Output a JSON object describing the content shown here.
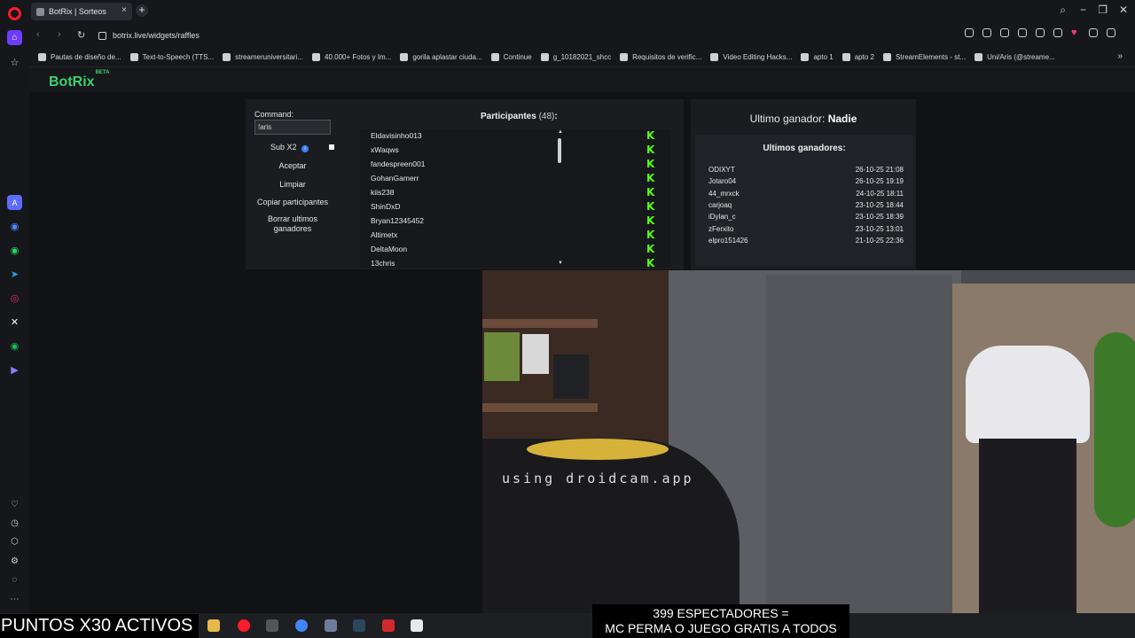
{
  "browser": {
    "tab_title": "BotRix | Sorteos",
    "tab_close": "×",
    "new_tab": "+",
    "url": "botrix.live/widgets/raffles",
    "window_controls": [
      "−",
      "❐",
      "✕"
    ]
  },
  "bookmarks": [
    {
      "label": "Pautas de diseño de...",
      "icon": "doc-icon"
    },
    {
      "label": "Text-to-Speech (TTS...",
      "icon": "tts-icon"
    },
    {
      "label": "streameruniversitari...",
      "icon": "twitch-icon"
    },
    {
      "label": "40.000+ Fotos y Im...",
      "icon": "photo-icon"
    },
    {
      "label": "gorila aplastar ciuda...",
      "icon": "google-icon"
    },
    {
      "label": "Continue",
      "icon": "doc-icon"
    },
    {
      "label": "g_10182021_shcc",
      "icon": "cloud-icon"
    },
    {
      "label": "Requisitos de verific...",
      "icon": "x-icon"
    },
    {
      "label": "Video Editing Hacks...",
      "icon": "youtube-icon"
    },
    {
      "label": "apto 1",
      "icon": "airbnb-icon"
    },
    {
      "label": "apto 2",
      "icon": "airbnb-icon"
    },
    {
      "label": "StreamElements - st...",
      "icon": "streamelements-icon"
    },
    {
      "label": "Uni/Aris (@streame...",
      "icon": "tiktok-icon"
    }
  ],
  "bookmarks_more": "»",
  "app": {
    "logo": "BotRix",
    "logo_badge": "BETA",
    "command_label": "Command:",
    "command_value": "!aris",
    "sub_x2_label": "Sub X2",
    "info_glyph": "i",
    "buttons": {
      "accept": "Aceptar",
      "clear": "Limpiar",
      "copy": "Copiar participantes",
      "delete_winners": "Borrar ultimos ganadores"
    },
    "participants_title": "Participantes",
    "participants_count": "(48)",
    "participants_colon": ":",
    "participants": [
      "Eldavisinho013",
      "xWaqws",
      "fandespreen001",
      "GohanGamerr",
      "kiis238",
      "ShinDxD",
      "Bryan12345452",
      "Altimetx",
      "DeltaMoon",
      "13chris"
    ],
    "platform_glyph": "K",
    "scroll_up": "▲",
    "scroll_down": "▼",
    "last_winner_label": "Ultimo ganador:",
    "last_winner_value": "Nadie",
    "winners_title": "Ultimos ganadores:",
    "winners": [
      {
        "name": "ODIXYT",
        "date": "26-10-25 21:08"
      },
      {
        "name": "Jotaro04",
        "date": "26-10-25 19:19"
      },
      {
        "name": "44_mrxck",
        "date": "24-10-25 18:11"
      },
      {
        "name": "carjoaq",
        "date": "23-10-25 18:44"
      },
      {
        "name": "iDylan_c",
        "date": "23-10-25 18:39"
      },
      {
        "name": "zFerxito",
        "date": "23-10-25 13:01"
      },
      {
        "name": "elpro151426",
        "date": "21-10-25 22:36"
      }
    ]
  },
  "stream": {
    "watermark": "using droidcam.app",
    "points_banner": "PUNTOS X30 ACTIVOS",
    "viewers_line1": "399 ESPECTADORES =",
    "viewers_line2": "MC PERMA O JUEGO GRATIS A TODOS"
  },
  "colors": {
    "accent_green": "#3bd16f",
    "kick_green": "#53fc18",
    "opera_red": "#ff1b2d",
    "opera_purple": "#6e3cff"
  }
}
